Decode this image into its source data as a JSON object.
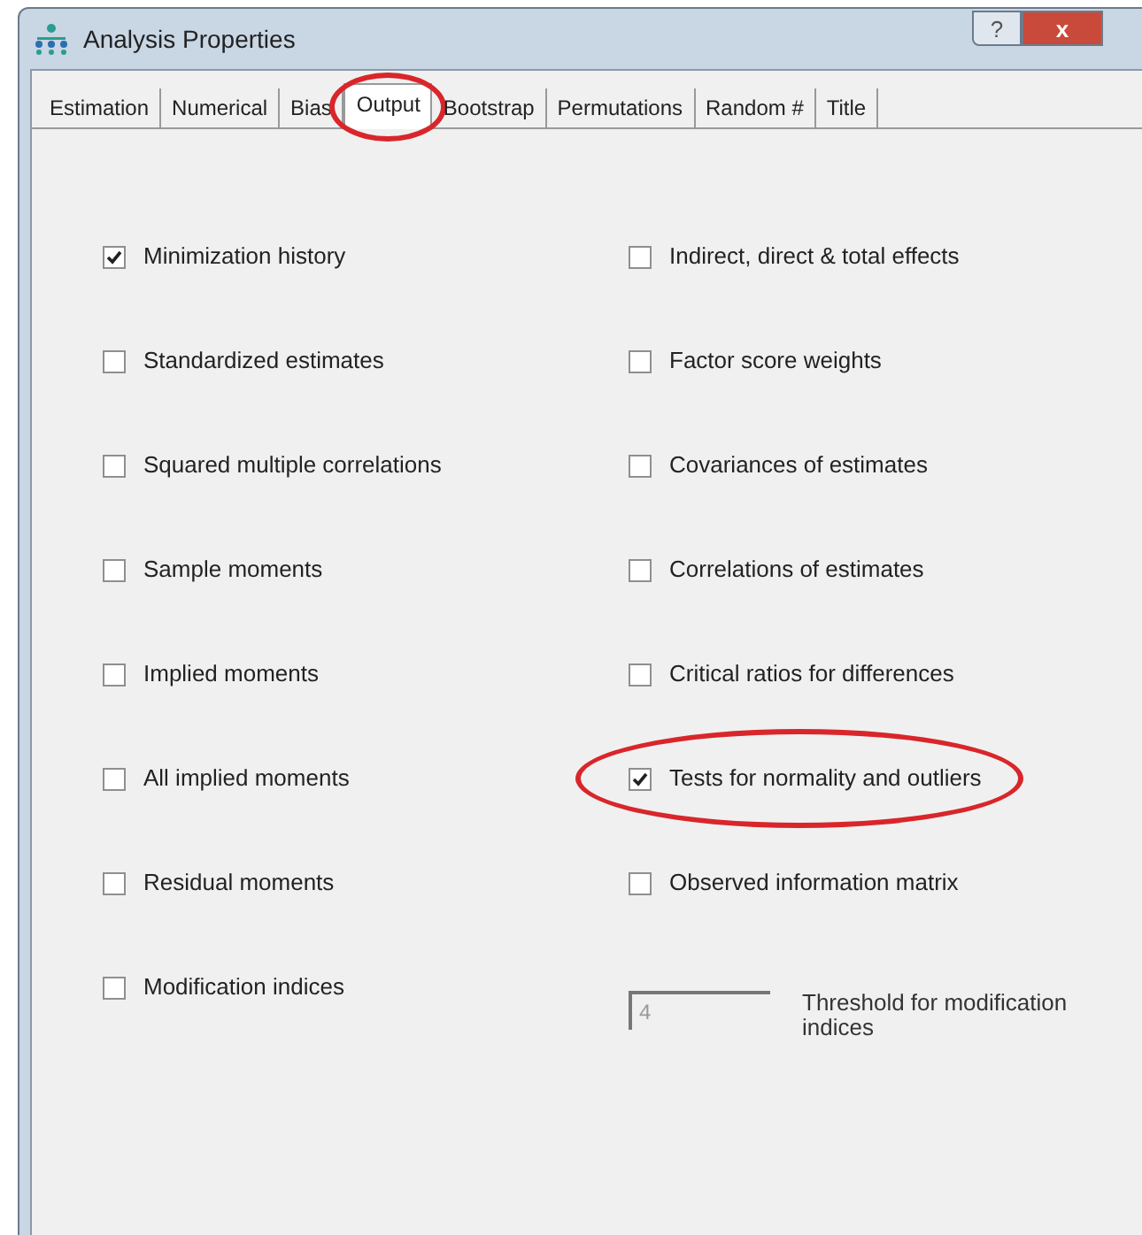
{
  "window": {
    "title": "Analysis Properties",
    "buttons": [
      "?",
      "x"
    ]
  },
  "tabs": [
    {
      "label": "Estimation",
      "selected": false,
      "circled": false
    },
    {
      "label": "Numerical",
      "selected": false,
      "circled": false
    },
    {
      "label": "Bias",
      "selected": false,
      "circled": false
    },
    {
      "label": "Output",
      "selected": true,
      "circled": true
    },
    {
      "label": "Bootstrap",
      "selected": false,
      "circled": false
    },
    {
      "label": "Permutations",
      "selected": false,
      "circled": false
    },
    {
      "label": "Random #",
      "selected": false,
      "circled": false
    },
    {
      "label": "Title",
      "selected": false,
      "circled": false
    }
  ],
  "left_options": [
    {
      "kind": "checkbox",
      "label": "Minimization history",
      "checked": true,
      "circled": false
    },
    {
      "kind": "checkbox",
      "label": "Standardized estimates",
      "checked": false,
      "circled": false
    },
    {
      "kind": "checkbox",
      "label": "Squared multiple correlations",
      "checked": false,
      "circled": false
    },
    {
      "kind": "checkbox",
      "label": "Sample moments",
      "checked": false,
      "circled": false
    },
    {
      "kind": "checkbox",
      "label": "Implied moments",
      "checked": false,
      "circled": false
    },
    {
      "kind": "checkbox",
      "label": "All implied moments",
      "checked": false,
      "circled": false
    },
    {
      "kind": "checkbox",
      "label": "Residual moments",
      "checked": false,
      "circled": false
    },
    {
      "kind": "checkbox",
      "label": "Modification indices",
      "checked": false,
      "circled": false
    }
  ],
  "right_options": [
    {
      "kind": "checkbox",
      "label": "Indirect, direct & total effects",
      "checked": false,
      "circled": false
    },
    {
      "kind": "checkbox",
      "label": "Factor score weights",
      "checked": false,
      "circled": false
    },
    {
      "kind": "checkbox",
      "label": "Covariances of estimates",
      "checked": false,
      "circled": false
    },
    {
      "kind": "checkbox",
      "label": "Correlations of estimates",
      "checked": false,
      "circled": false
    },
    {
      "kind": "checkbox",
      "label": "Critical ratios for differences",
      "checked": false,
      "circled": false
    },
    {
      "kind": "checkbox",
      "label": "Tests for normality and outliers",
      "checked": true,
      "circled": true
    },
    {
      "kind": "checkbox",
      "label": "Observed information matrix",
      "checked": false,
      "circled": false
    },
    {
      "kind": "field",
      "label": "Threshold for modification indices",
      "value": "4",
      "disabled": true,
      "circled": false
    }
  ]
}
